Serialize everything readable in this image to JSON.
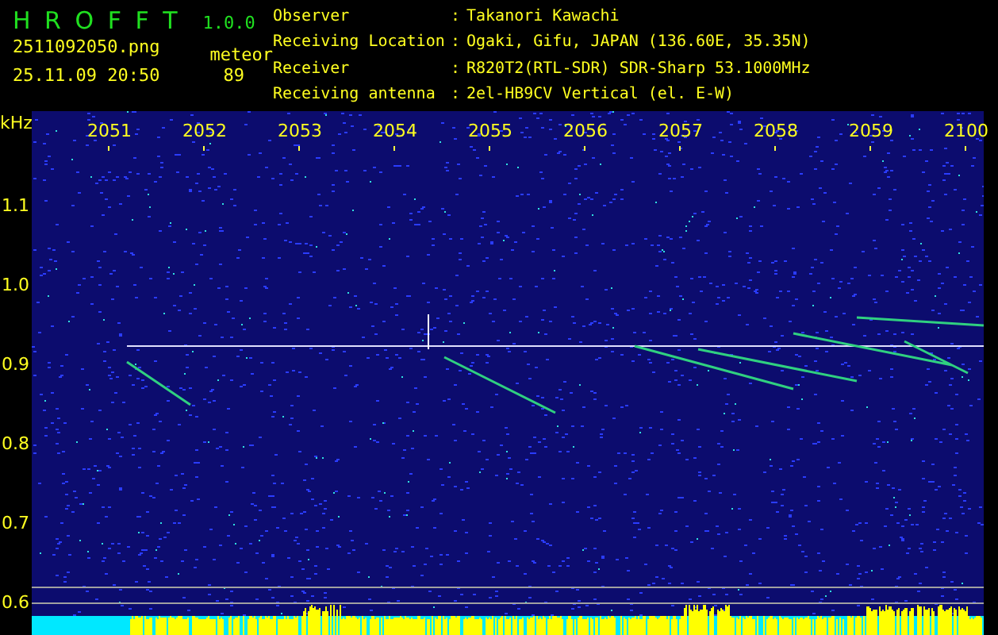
{
  "app": {
    "name": "H R O F F T",
    "version": "1.0.0"
  },
  "file": {
    "filename": "2511092050.png",
    "timestamp": "25.11.09 20:50"
  },
  "count": {
    "label": "meteor",
    "value": "89"
  },
  "info": [
    {
      "label": "Observer",
      "separator": ":",
      "value": "Takanori Kawachi"
    },
    {
      "label": "Receiving Location",
      "separator": ":",
      "value": "Ogaki, Gifu, JAPAN (136.60E, 35.35N)"
    },
    {
      "label": "Receiver",
      "separator": ":",
      "value": "R820T2(RTL-SDR) SDR-Sharp 53.1000MHz"
    },
    {
      "label": "Receiving antenna",
      "separator": ":",
      "value": "2el-HB9CV Vertical (el. E-W)"
    }
  ],
  "spectrogram": {
    "y_unit": "kHz",
    "x_labels": [
      "2051",
      "2052",
      "2053",
      "2054",
      "2055",
      "2056",
      "2057",
      "2058",
      "2059",
      "2100"
    ],
    "y_labels": [
      "1.1",
      "1.0",
      "0.9",
      "0.8",
      "0.7",
      "0.6"
    ]
  }
}
